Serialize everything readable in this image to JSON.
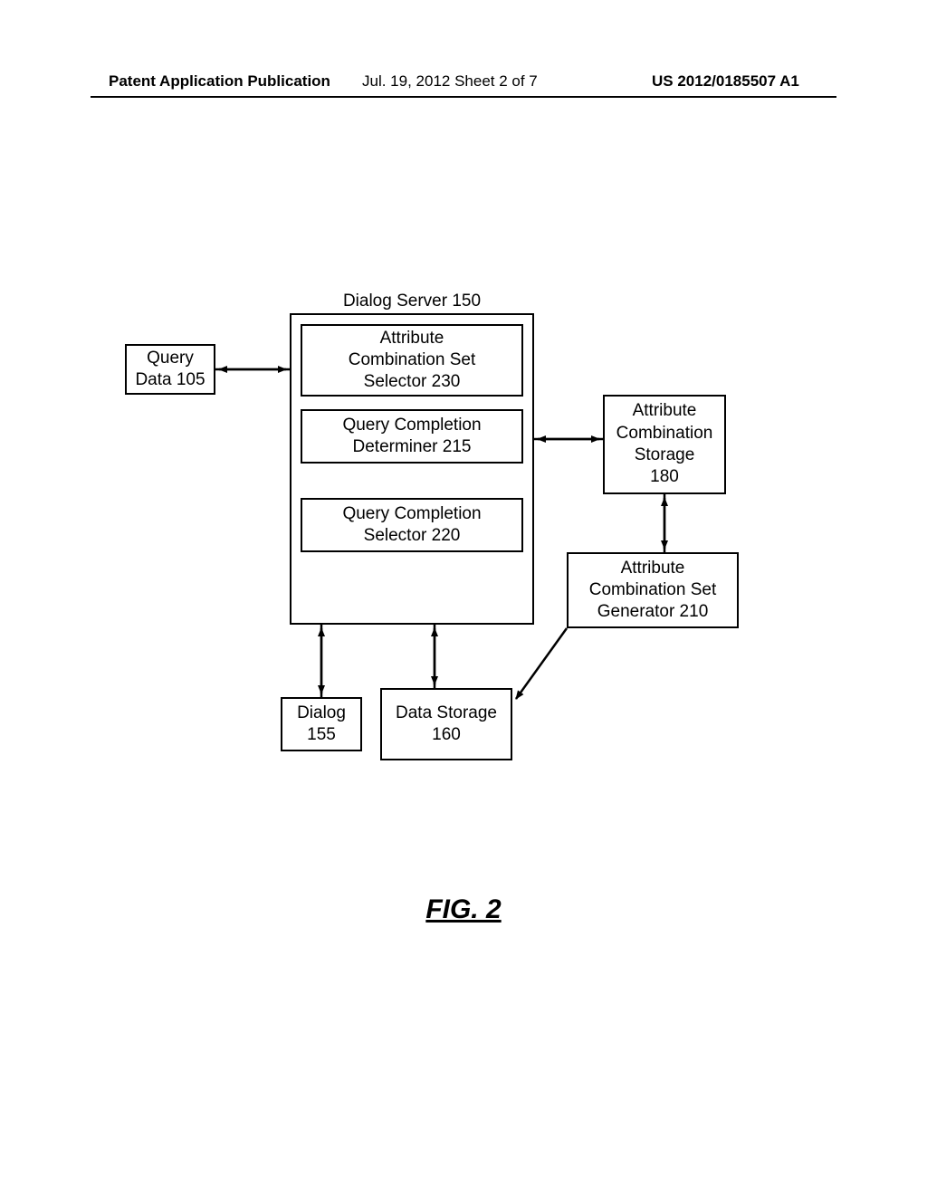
{
  "header": {
    "left": "Patent Application Publication",
    "center": "Jul. 19, 2012  Sheet 2 of 7",
    "right": "US 2012/0185507 A1"
  },
  "diagram": {
    "server_title": "Dialog Server 150",
    "query_data": "Query\nData 105",
    "attr_comb_set_selector": "Attribute\nCombination Set\nSelector 230",
    "query_completion_determiner": "Query Completion\nDeterminer 215",
    "query_completion_selector": "Query Completion\nSelector 220",
    "attr_comb_storage": "Attribute\nCombination\nStorage\n180",
    "attr_comb_set_generator": "Attribute\nCombination Set\nGenerator 210",
    "dialog": "Dialog\n155",
    "data_storage": "Data Storage\n160"
  },
  "figure_caption": "FIG. 2"
}
